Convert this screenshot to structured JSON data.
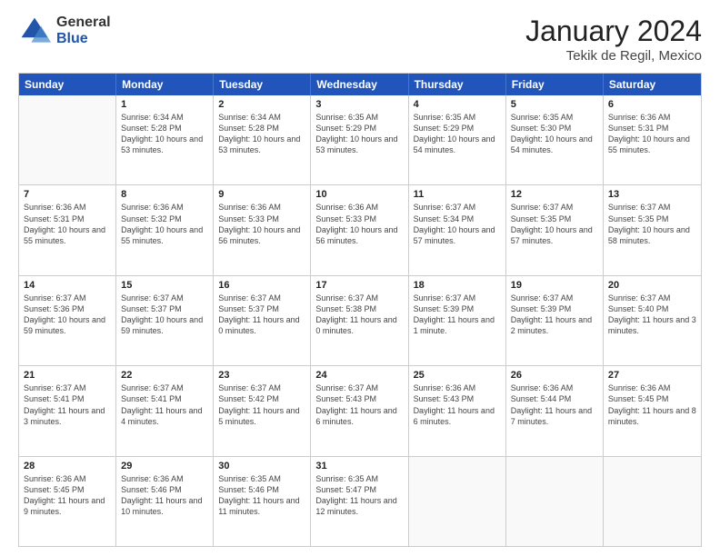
{
  "logo": {
    "general": "General",
    "blue": "Blue"
  },
  "title": "January 2024",
  "subtitle": "Tekik de Regil, Mexico",
  "weekdays": [
    "Sunday",
    "Monday",
    "Tuesday",
    "Wednesday",
    "Thursday",
    "Friday",
    "Saturday"
  ],
  "weeks": [
    [
      {
        "day": "",
        "text": ""
      },
      {
        "day": "1",
        "text": "Sunrise: 6:34 AM\nSunset: 5:28 PM\nDaylight: 10 hours\nand 53 minutes."
      },
      {
        "day": "2",
        "text": "Sunrise: 6:34 AM\nSunset: 5:28 PM\nDaylight: 10 hours\nand 53 minutes."
      },
      {
        "day": "3",
        "text": "Sunrise: 6:35 AM\nSunset: 5:29 PM\nDaylight: 10 hours\nand 53 minutes."
      },
      {
        "day": "4",
        "text": "Sunrise: 6:35 AM\nSunset: 5:29 PM\nDaylight: 10 hours\nand 54 minutes."
      },
      {
        "day": "5",
        "text": "Sunrise: 6:35 AM\nSunset: 5:30 PM\nDaylight: 10 hours\nand 54 minutes."
      },
      {
        "day": "6",
        "text": "Sunrise: 6:36 AM\nSunset: 5:31 PM\nDaylight: 10 hours\nand 55 minutes."
      }
    ],
    [
      {
        "day": "7",
        "text": "Sunrise: 6:36 AM\nSunset: 5:31 PM\nDaylight: 10 hours\nand 55 minutes."
      },
      {
        "day": "8",
        "text": "Sunrise: 6:36 AM\nSunset: 5:32 PM\nDaylight: 10 hours\nand 55 minutes."
      },
      {
        "day": "9",
        "text": "Sunrise: 6:36 AM\nSunset: 5:33 PM\nDaylight: 10 hours\nand 56 minutes."
      },
      {
        "day": "10",
        "text": "Sunrise: 6:36 AM\nSunset: 5:33 PM\nDaylight: 10 hours\nand 56 minutes."
      },
      {
        "day": "11",
        "text": "Sunrise: 6:37 AM\nSunset: 5:34 PM\nDaylight: 10 hours\nand 57 minutes."
      },
      {
        "day": "12",
        "text": "Sunrise: 6:37 AM\nSunset: 5:35 PM\nDaylight: 10 hours\nand 57 minutes."
      },
      {
        "day": "13",
        "text": "Sunrise: 6:37 AM\nSunset: 5:35 PM\nDaylight: 10 hours\nand 58 minutes."
      }
    ],
    [
      {
        "day": "14",
        "text": "Sunrise: 6:37 AM\nSunset: 5:36 PM\nDaylight: 10 hours\nand 59 minutes."
      },
      {
        "day": "15",
        "text": "Sunrise: 6:37 AM\nSunset: 5:37 PM\nDaylight: 10 hours\nand 59 minutes."
      },
      {
        "day": "16",
        "text": "Sunrise: 6:37 AM\nSunset: 5:37 PM\nDaylight: 11 hours\nand 0 minutes."
      },
      {
        "day": "17",
        "text": "Sunrise: 6:37 AM\nSunset: 5:38 PM\nDaylight: 11 hours\nand 0 minutes."
      },
      {
        "day": "18",
        "text": "Sunrise: 6:37 AM\nSunset: 5:39 PM\nDaylight: 11 hours\nand 1 minute."
      },
      {
        "day": "19",
        "text": "Sunrise: 6:37 AM\nSunset: 5:39 PM\nDaylight: 11 hours\nand 2 minutes."
      },
      {
        "day": "20",
        "text": "Sunrise: 6:37 AM\nSunset: 5:40 PM\nDaylight: 11 hours\nand 3 minutes."
      }
    ],
    [
      {
        "day": "21",
        "text": "Sunrise: 6:37 AM\nSunset: 5:41 PM\nDaylight: 11 hours\nand 3 minutes."
      },
      {
        "day": "22",
        "text": "Sunrise: 6:37 AM\nSunset: 5:41 PM\nDaylight: 11 hours\nand 4 minutes."
      },
      {
        "day": "23",
        "text": "Sunrise: 6:37 AM\nSunset: 5:42 PM\nDaylight: 11 hours\nand 5 minutes."
      },
      {
        "day": "24",
        "text": "Sunrise: 6:37 AM\nSunset: 5:43 PM\nDaylight: 11 hours\nand 6 minutes."
      },
      {
        "day": "25",
        "text": "Sunrise: 6:36 AM\nSunset: 5:43 PM\nDaylight: 11 hours\nand 6 minutes."
      },
      {
        "day": "26",
        "text": "Sunrise: 6:36 AM\nSunset: 5:44 PM\nDaylight: 11 hours\nand 7 minutes."
      },
      {
        "day": "27",
        "text": "Sunrise: 6:36 AM\nSunset: 5:45 PM\nDaylight: 11 hours\nand 8 minutes."
      }
    ],
    [
      {
        "day": "28",
        "text": "Sunrise: 6:36 AM\nSunset: 5:45 PM\nDaylight: 11 hours\nand 9 minutes."
      },
      {
        "day": "29",
        "text": "Sunrise: 6:36 AM\nSunset: 5:46 PM\nDaylight: 11 hours\nand 10 minutes."
      },
      {
        "day": "30",
        "text": "Sunrise: 6:35 AM\nSunset: 5:46 PM\nDaylight: 11 hours\nand 11 minutes."
      },
      {
        "day": "31",
        "text": "Sunrise: 6:35 AM\nSunset: 5:47 PM\nDaylight: 11 hours\nand 12 minutes."
      },
      {
        "day": "",
        "text": ""
      },
      {
        "day": "",
        "text": ""
      },
      {
        "day": "",
        "text": ""
      }
    ]
  ]
}
